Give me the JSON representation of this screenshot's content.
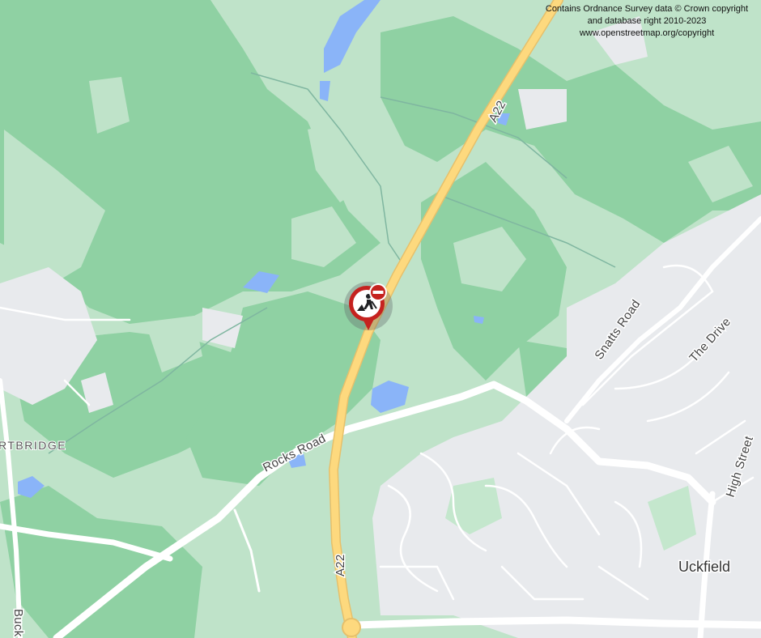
{
  "attribution": {
    "line1": "Contains Ordnance Survey data © Crown copyright",
    "line2": "and database right 2010-2023",
    "line3": "www.openstreetmap.org/copyright"
  },
  "labels": {
    "a22_north": "A22",
    "a22_south": "A22",
    "rocks_road": "Rocks Road",
    "snatts_road": "Snatts Road",
    "the_drive": "The Drive",
    "high_street": "High Street",
    "uckfield": "Uckfield",
    "ridgebridge": "RTBRIDGE",
    "buck": "Buck"
  },
  "marker": {
    "type": "roadworks-closure",
    "icon": "roadworks-icon",
    "badge": "no-entry-icon"
  },
  "colors": {
    "woodland": "#8fd1a3",
    "open_land": "#bfe3c9",
    "urban": "#e8eaed",
    "water": "#8ab4f8",
    "major_road": "#fdd97e",
    "minor_road": "#ffffff",
    "marker_red": "#c5221f"
  }
}
